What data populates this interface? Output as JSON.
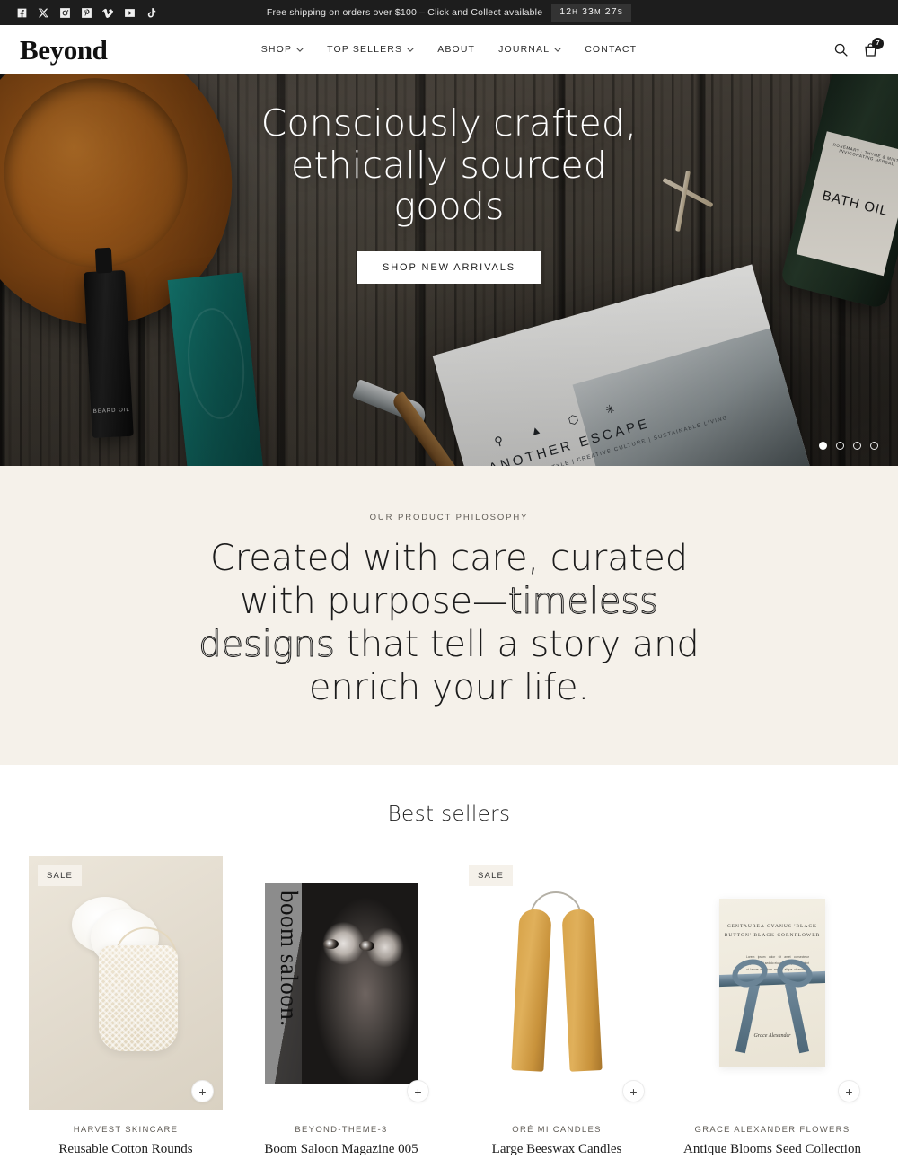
{
  "announcement": {
    "social": [
      {
        "name": "facebook-icon",
        "label": "Facebook"
      },
      {
        "name": "x-icon",
        "label": "X"
      },
      {
        "name": "instagram-icon",
        "label": "Instagram"
      },
      {
        "name": "pinterest-icon",
        "label": "Pinterest"
      },
      {
        "name": "vimeo-icon",
        "label": "Vimeo"
      },
      {
        "name": "youtube-icon",
        "label": "YouTube"
      },
      {
        "name": "tiktok-icon",
        "label": "TikTok"
      }
    ],
    "message": "Free shipping on orders over $100 – Click and Collect available",
    "timer": {
      "hours": "12",
      "hours_unit": "H",
      "minutes": "33",
      "minutes_unit": "M",
      "seconds": "27",
      "seconds_unit": "S",
      "full": "12H 33M 27S"
    }
  },
  "header": {
    "logo": "Beyond",
    "nav": [
      {
        "label": "SHOP",
        "has_dropdown": true
      },
      {
        "label": "TOP SELLERS",
        "has_dropdown": true
      },
      {
        "label": "ABOUT",
        "has_dropdown": false
      },
      {
        "label": "JOURNAL",
        "has_dropdown": true
      },
      {
        "label": "CONTACT",
        "has_dropdown": false
      }
    ],
    "search_icon": "search-icon",
    "cart_icon": "cart-icon",
    "cart_count": "7"
  },
  "hero": {
    "title": "Consciously crafted, ethically sourced goods",
    "cta_label": "SHOP NEW ARRIVALS",
    "slides": 4,
    "active_slide": 1,
    "image_elements": {
      "magazine_title": "ANOTHER ESCAPE",
      "magazine_subtitle": "OUTDOOR LIFESTYLE | CREATIVE CULTURE | SUSTAINABLE LIVING",
      "magazine_glyphs": "⚲ ▲ ⬡ ✳",
      "bottle_label": "BATH OIL",
      "bottle_label_small": "ROSEMARY · THYME & MINT · INVIGORATING HERBAL",
      "beard_oil_label": "BEARD OIL"
    }
  },
  "philosophy": {
    "eyebrow": "OUR PRODUCT PHILOSOPHY",
    "heading_part1": "Created with care, curated with purpose—",
    "heading_outlined": "timeless designs",
    "heading_part2": " that tell a story and enrich your life."
  },
  "bestsellers": {
    "title": "Best sellers",
    "add_label": "+",
    "products": [
      {
        "vendor": "HARVEST SKINCARE",
        "title": "Reusable Cotton Rounds",
        "badge": "SALE",
        "art": "skincare"
      },
      {
        "vendor": "BEYOND-THEME-3",
        "title": "Boom Saloon Magazine 005",
        "badge": "",
        "art": "magazine",
        "cover_text": "boom saloon."
      },
      {
        "vendor": "ORÉ MI CANDLES",
        "title": "Large Beeswax Candles",
        "badge": "SALE",
        "art": "candles"
      },
      {
        "vendor": "GRACE ALEXANDER FLOWERS",
        "title": "Antique Blooms Seed Collection",
        "badge": "",
        "art": "seeds",
        "packet_text": "CENTAUREA CYANUS 'BLACK BUTTON' BLACK CORNFLOWER",
        "packet_sig": "Grace Alexander"
      }
    ]
  },
  "colors": {
    "announcement_bg": "#1d1d1d",
    "timer_bg": "#333333",
    "philosophy_bg": "#f5f1ea",
    "badge_bg": "#f5f1ea",
    "text_dark": "#1c1c1c",
    "text_muted": "#5f5b55"
  }
}
